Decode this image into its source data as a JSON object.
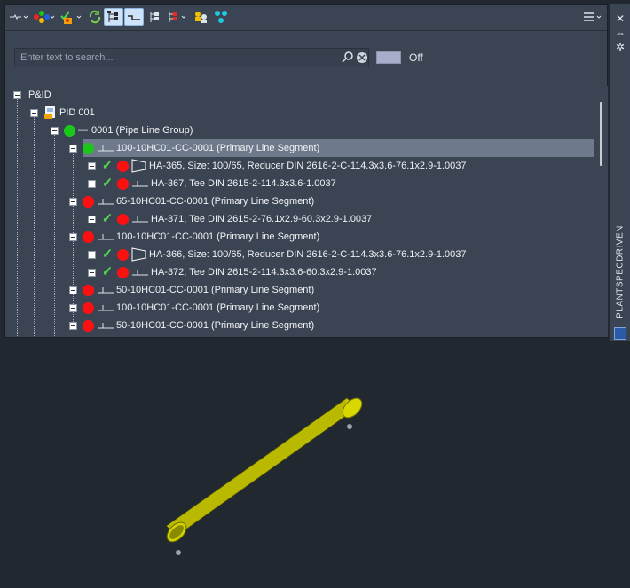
{
  "toolbar": {
    "buttons": [
      {
        "name": "line-filter-icon",
        "active": false
      },
      {
        "name": "color-dots-icon",
        "active": false
      },
      {
        "name": "validate-icon",
        "active": false
      },
      {
        "name": "refresh-icon",
        "active": false
      },
      {
        "name": "tree-view-icon",
        "active": true
      },
      {
        "name": "segment-view-icon",
        "active": true
      },
      {
        "name": "hierarchy-icon",
        "active": false
      },
      {
        "name": "hierarchy-color-icon",
        "active": false
      },
      {
        "name": "people-icon",
        "active": false
      },
      {
        "name": "network-icon",
        "active": false
      }
    ],
    "menu_icon": "hamburger-menu-icon"
  },
  "search": {
    "placeholder": "Enter text to search..."
  },
  "toggle": {
    "label": "Off"
  },
  "tree": {
    "rows": [
      {
        "level": 0,
        "label": "P&ID",
        "icon": "none"
      },
      {
        "level": 1,
        "label": "PID 001",
        "icon": "pid-document-icon"
      },
      {
        "level": 2,
        "label": "0001 (Pipe Line Group)",
        "icon": "green-line"
      },
      {
        "level": 3,
        "label": "100-10HC01-CC-0001 (Primary Line Segment)",
        "icon": "green-segment",
        "selected": true
      },
      {
        "level": 4,
        "label": "HA-365, Size: 100/65, Reducer DIN 2616-2-C-114.3x3.6-76.1x2.9-1.0037",
        "icon": "check-red-reducer"
      },
      {
        "level": 4,
        "label": "HA-367, Tee DIN 2615-2-114.3x3.6-1.0037",
        "icon": "check-red-segment"
      },
      {
        "level": 3,
        "label": "65-10HC01-CC-0001 (Primary Line Segment)",
        "icon": "red-segment"
      },
      {
        "level": 4,
        "label": "HA-371, Tee DIN 2615-2-76.1x2.9-60.3x2.9-1.0037",
        "icon": "check-red-segment"
      },
      {
        "level": 3,
        "label": "100-10HC01-CC-0001 (Primary Line Segment)",
        "icon": "red-segment"
      },
      {
        "level": 4,
        "label": "HA-366, Size: 100/65, Reducer DIN 2616-2-C-114.3x3.6-76.1x2.9-1.0037",
        "icon": "check-red-reducer"
      },
      {
        "level": 4,
        "label": "HA-372, Tee DIN 2615-2-114.3x3.6-60.3x2.9-1.0037",
        "icon": "check-red-segment"
      },
      {
        "level": 3,
        "label": "50-10HC01-CC-0001 (Primary Line Segment)",
        "icon": "red-segment"
      },
      {
        "level": 3,
        "label": "100-10HC01-CC-0001 (Primary Line Segment)",
        "icon": "red-segment"
      },
      {
        "level": 3,
        "label": "50-10HC01-CC-0001 (Primary Line Segment)",
        "icon": "red-segment"
      }
    ]
  },
  "sidebar": {
    "vertical_tab_label": "PLANTSPECDRIVEN",
    "buttons": [
      "close-icon",
      "pin-icon",
      "settings-icon"
    ]
  },
  "viewport": {
    "object": "yellow-pipe",
    "pipe_color": "#cfd000"
  }
}
